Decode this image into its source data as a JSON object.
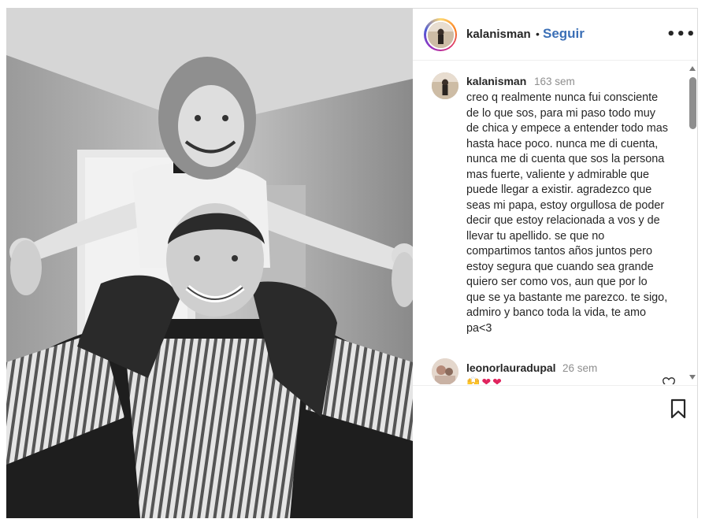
{
  "photo": {
    "alt_subject": "post-photo"
  },
  "header": {
    "username": "kalanisman",
    "separator": "•",
    "follow_label": "Seguir",
    "more_label": "•••"
  },
  "comments": [
    {
      "username": "kalanisman",
      "time": "163 sem",
      "text": "creo q realmente nunca fui consciente\nde lo que sos, para mi paso todo muy\nde chica y empece a entender todo mas\nhasta hace poco. nunca me di cuenta,\nnunca me di cuenta que sos la persona\nmas fuerte, valiente y admirable que\npuede llegar a existir. agradezco que\nseas mi papa, estoy orgullosa de poder\ndecir que estoy relacionada a vos y de\nllevar tu apellido. se que no\ncompartimos tantos años juntos pero\nestoy segura que cuando sea grande\nquiero ser como vos, aun que por lo\nque se ya bastante me parezco. te sigo,\nadmiro y banco toda la vida, te amo\npa<3"
    },
    {
      "username": "leonorlauradupal",
      "time": "26 sem",
      "emojis": [
        "🙌",
        "❤",
        "❤"
      ]
    }
  ],
  "colors": {
    "follow": "#3b6fb6",
    "heart_emoji": "#e0245e",
    "muted_text": "#8e8e8e"
  },
  "icons": {
    "more": "more-options-icon",
    "like": "heart-outline-icon",
    "save": "bookmark-icon"
  }
}
